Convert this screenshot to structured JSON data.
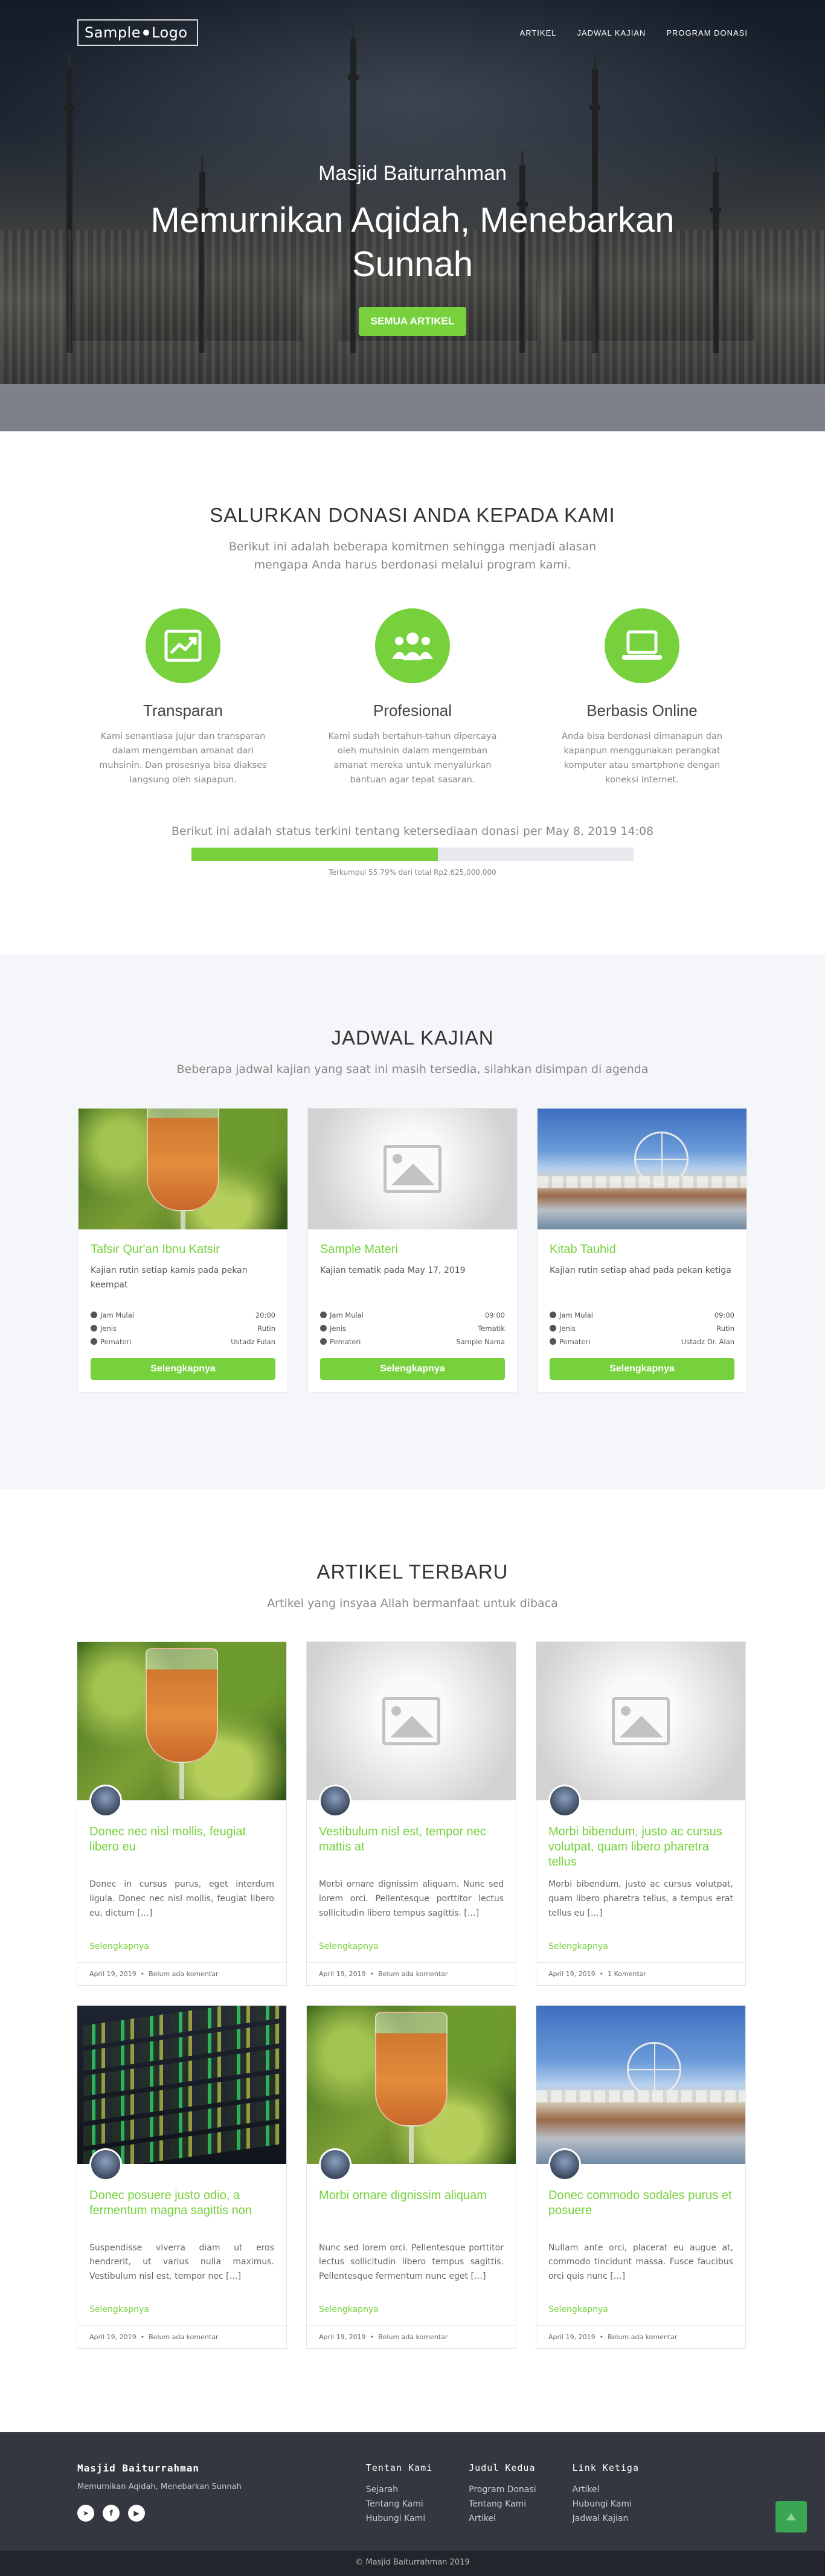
{
  "nav": {
    "logo_left": "Sample",
    "logo_right": "Logo",
    "links": [
      "ARTIKEL",
      "JADWAL KAJIAN",
      "PROGRAM DONASI"
    ]
  },
  "hero": {
    "subtitle": "Masjid Baiturrahman",
    "title": "Memurnikan Aqidah, Menebarkan Sunnah",
    "button": "SEMUA ARTIKEL"
  },
  "donasi": {
    "title": "SALURKAN DONASI ANDA KEPADA KAMI",
    "subtitle": "Berikut ini adalah beberapa komitmen sehingga menjadi alasan mengapa Anda harus berdonasi melalui program kami.",
    "features": [
      {
        "icon": "trending-up-icon",
        "title": "Transparan",
        "text": "Kami senantiasa jujur dan transparan dalam mengemban amanat dari muhsinin. Dan prosesnya bisa diakses langsung oleh siapapun."
      },
      {
        "icon": "team-icon",
        "title": "Profesional",
        "text": "Kami sudah bertahun-tahun dipercaya oleh muhsinin dalam mengemban amanat mereka untuk menyalurkan bantuan agar tepat sasaran."
      },
      {
        "icon": "laptop-icon",
        "title": "Berbasis Online",
        "text": "Anda bisa berdonasi dimanapun dan kapanpun menggunakan perangkat komputer atau smartphone dengan koneksi internet."
      }
    ],
    "status_text": "Berikut ini adalah status terkini tentang ketersediaan donasi per May 8, 2019 14:08",
    "progress_percent": 55.79,
    "progress_caption": "Terkumpul 55.79% dari total Rp2,625,000,000"
  },
  "jadwal": {
    "title": "JADWAL KAJIAN",
    "subtitle": "Beberapa jadwal kajian yang saat ini masih tersedia, silahkan disimpan di agenda",
    "labels": {
      "jam": "Jam Mulai",
      "jenis": "Jenis",
      "pemateri": "Pemateri"
    },
    "button": "Selengkapnya",
    "cards": [
      {
        "title": "Tafsir Qur'an Ibnu Katsir",
        "desc": "Kajian rutin setiap kamis pada pekan keempat",
        "jam": "20:00",
        "jenis": "Rutin",
        "pemateri": "Ustadz Fulan"
      },
      {
        "title": "Sample Materi",
        "desc": "Kajian tematik pada May 17, 2019",
        "jam": "09:00",
        "jenis": "Tematik",
        "pemateri": "Sample Nama"
      },
      {
        "title": "Kitab Tauhid",
        "desc": "Kajian rutin setiap ahad pada pekan ketiga",
        "jam": "09:00",
        "jenis": "Rutin",
        "pemateri": "Ustadz Dr. Alan"
      }
    ]
  },
  "artikel": {
    "title": "ARTIKEL TERBARU",
    "subtitle": "Artikel yang insyaa Allah bermanfaat untuk dibaca",
    "read_more": "Selengkapnya",
    "items": [
      {
        "title": "Donec nec nisl mollis, feugiat libero eu",
        "excerpt": "Donec in cursus purus, eget interdum ligula. Donec nec nisl mollis, feugiat libero eu, dictum […]",
        "date": "April 19, 2019",
        "comments": "Belum ada komentar"
      },
      {
        "title": "Vestibulum nisl est, tempor nec mattis at",
        "excerpt": "Morbi ornare dignissim aliquam. Nunc sed lorem orci. Pellentesque porttitor lectus sollicitudin libero tempus sagittis. […]",
        "date": "April 19, 2019",
        "comments": "Belum ada komentar"
      },
      {
        "title": "Morbi bibendum, justo ac cursus volutpat, quam libero pharetra tellus",
        "excerpt": "Morbi bibendum, justo ac cursus volutpat, quam libero pharetra tellus, a tempus erat tellus eu […]",
        "date": "April 19, 2019",
        "comments": "1 Komentar"
      },
      {
        "title": "Donec posuere justo odio, a fermentum magna sagittis non",
        "excerpt": "Suspendisse viverra diam ut eros hendrerit, ut varius nulla maximus. Vestibulum nisl est, tempor nec […]",
        "date": "April 19, 2019",
        "comments": "Belum ada komentar"
      },
      {
        "title": "Morbi ornare dignissim aliquam",
        "excerpt": "Nunc sed lorem orci. Pellentesque porttitor lectus sollicitudin libero tempus sagittis. Pellentesque fermentum nunc eget […]",
        "date": "April 19, 2019",
        "comments": "Belum ada komentar"
      },
      {
        "title": "Donec commodo sodales purus et posuere",
        "excerpt": "Nullam ante orci, placerat eu augue at, commodo tincidunt massa. Fusce faucibus orci quis nunc […]",
        "date": "April 19, 2019",
        "comments": "Belum ada komentar"
      }
    ]
  },
  "footer": {
    "brand": "Masjid Baiturrahman",
    "tagline": "Memurnikan Aqidah, Menebarkan Sunnah",
    "columns": [
      {
        "title": "Tentan Kami",
        "links": [
          "Sejarah",
          "Tentang Kami",
          "Hubungi Kami"
        ]
      },
      {
        "title": "Judul Kedua",
        "links": [
          "Program Donasi",
          "Tentang Kami",
          "Artikel"
        ]
      },
      {
        "title": "Link Ketiga",
        "links": [
          "Artikel",
          "Hubungi Kami",
          "Jadwal Kajian"
        ]
      }
    ],
    "copyright": "© Masjid Baiturrahman 2019"
  },
  "colors": {
    "accent": "#76d13c",
    "footer": "#34373f",
    "copyright_bar": "#22252b"
  }
}
